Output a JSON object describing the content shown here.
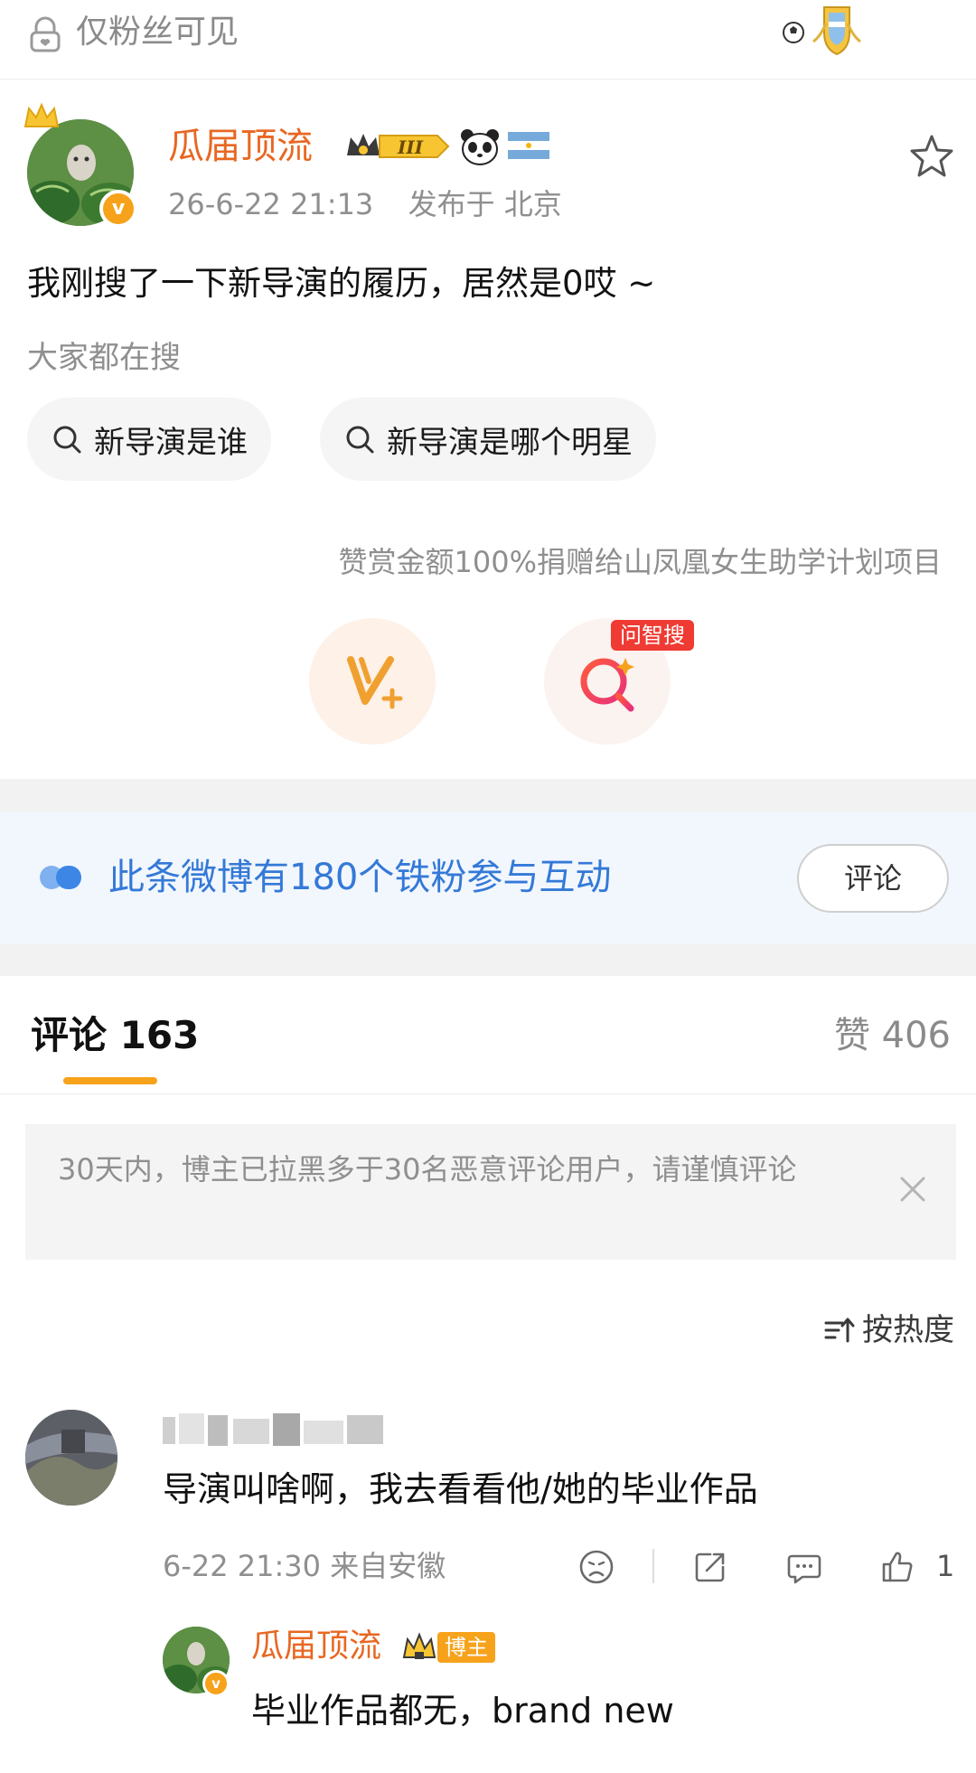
{
  "topbar": {
    "visibility_label": "仅粉丝可见"
  },
  "post": {
    "author": "瓜届顶流",
    "level_badge": "III",
    "timestamp": "26-6-22 21:13",
    "location": "发布于 北京",
    "text": "我刚搜了一下新导演的履历，居然是0哎 ~",
    "everyone_searching": "大家都在搜",
    "search_chips": [
      "新导演是谁",
      "新导演是哪个明星"
    ],
    "donation_note": "赞赏金额100%捐赠给山凤凰女生助学计划项目",
    "ask_search_tag": "问智搜"
  },
  "fans": {
    "label": "此条微博有180个铁粉参与互动",
    "button": "评论"
  },
  "comments_header": {
    "tab_label": "评论 163",
    "likes_label": "赞 406"
  },
  "notice": {
    "text": "30天内，博主已拉黑多于30名恶意评论用户，请谨慎评论"
  },
  "sort": {
    "label": "按热度"
  },
  "comment": {
    "text": "导演叫啥啊，我去看看他/她的毕业作品",
    "meta": "6-22 21:30 来自安徽",
    "like_count": "1"
  },
  "reply": {
    "author": "瓜届顶流",
    "tag": "博主",
    "text": "毕业作品都无，brand new"
  },
  "colors": {
    "accent_orange": "#e86722",
    "link_blue": "#3479d7",
    "badge_gold": "#f7a21b",
    "tag_red": "#ef3b33"
  }
}
